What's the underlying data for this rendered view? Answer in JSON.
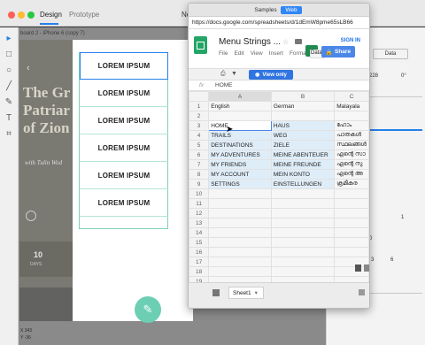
{
  "xd": {
    "tabs": [
      "Design",
      "Prototype"
    ],
    "doc_title": "Ne",
    "artboard_label": "board 2 - iPhone 6 (copy 7)",
    "hero_lines": [
      "The Gr",
      "Patriar",
      "of Zion"
    ],
    "hero_subtitle": "with Tulin Wod",
    "hero_number": "10",
    "hero_days": "DAYS",
    "menu_items": [
      "LOREM IPSUM",
      "LOREM IPSUM",
      "LOREM IPSUM",
      "LOREM IPSUM",
      "LOREM IPSUM",
      "LOREM IPSUM"
    ],
    "coord_x": "X  343",
    "coord_y": "Y  -36",
    "inspector": {
      "data_button": "Data",
      "value_1": "228",
      "value_2": "0°",
      "value_3": "1",
      "value_4": "3",
      "value_5": "6",
      "value_6": "0"
    }
  },
  "browser": {
    "segments": {
      "samples": "Samples",
      "web": "Web"
    },
    "url": "https://docs.google.com/spreadsheets/d/1dEmW8pme65sLB66"
  },
  "sheet": {
    "title": "Menu Strings ...",
    "menus": [
      "File",
      "Edit",
      "View",
      "Insert",
      "Format"
    ],
    "sign_in": "SIGN IN",
    "data_label": "Data",
    "share": "Share",
    "view_only": "View only",
    "fx": "fx",
    "formula_value": "HOME",
    "columns": [
      "A",
      "B",
      "C"
    ],
    "rows": [
      {
        "n": "1",
        "a": "English",
        "b": "German",
        "c": "Malayala"
      },
      {
        "n": "2",
        "a": "",
        "b": "",
        "c": ""
      },
      {
        "n": "3",
        "a": "HOME",
        "b": "HAUS",
        "c": "ഹോം"
      },
      {
        "n": "4",
        "a": "TRAILS",
        "b": "WEG",
        "c": "പാതകൾ"
      },
      {
        "n": "5",
        "a": "DESTINATIONS",
        "b": "ZIELE",
        "c": "സ്ഥലങ്ങൾ"
      },
      {
        "n": "6",
        "a": "MY ADVENTURES",
        "b": "MEINE ABENTEUER",
        "c": "എന്റെ സാ"
      },
      {
        "n": "7",
        "a": "MY FRIENDS",
        "b": "MEINE FREUNDE",
        "c": "എന്റെ സു"
      },
      {
        "n": "8",
        "a": "MY ACCOUNT",
        "b": "MEIN KONTO",
        "c": "എന്റെ അ"
      },
      {
        "n": "9",
        "a": "SETTINGS",
        "b": "EINSTELLUNGEN",
        "c": "ക്രമീകര"
      },
      {
        "n": "10",
        "a": "",
        "b": "",
        "c": ""
      },
      {
        "n": "11",
        "a": "",
        "b": "",
        "c": ""
      },
      {
        "n": "12",
        "a": "",
        "b": "",
        "c": ""
      },
      {
        "n": "13",
        "a": "",
        "b": "",
        "c": ""
      },
      {
        "n": "14",
        "a": "",
        "b": "",
        "c": ""
      },
      {
        "n": "15",
        "a": "",
        "b": "",
        "c": ""
      },
      {
        "n": "16",
        "a": "",
        "b": "",
        "c": ""
      },
      {
        "n": "17",
        "a": "",
        "b": "",
        "c": ""
      },
      {
        "n": "18",
        "a": "",
        "b": "",
        "c": ""
      },
      {
        "n": "19",
        "a": "",
        "b": "",
        "c": ""
      }
    ],
    "sheet_tab": "Sheet1"
  }
}
